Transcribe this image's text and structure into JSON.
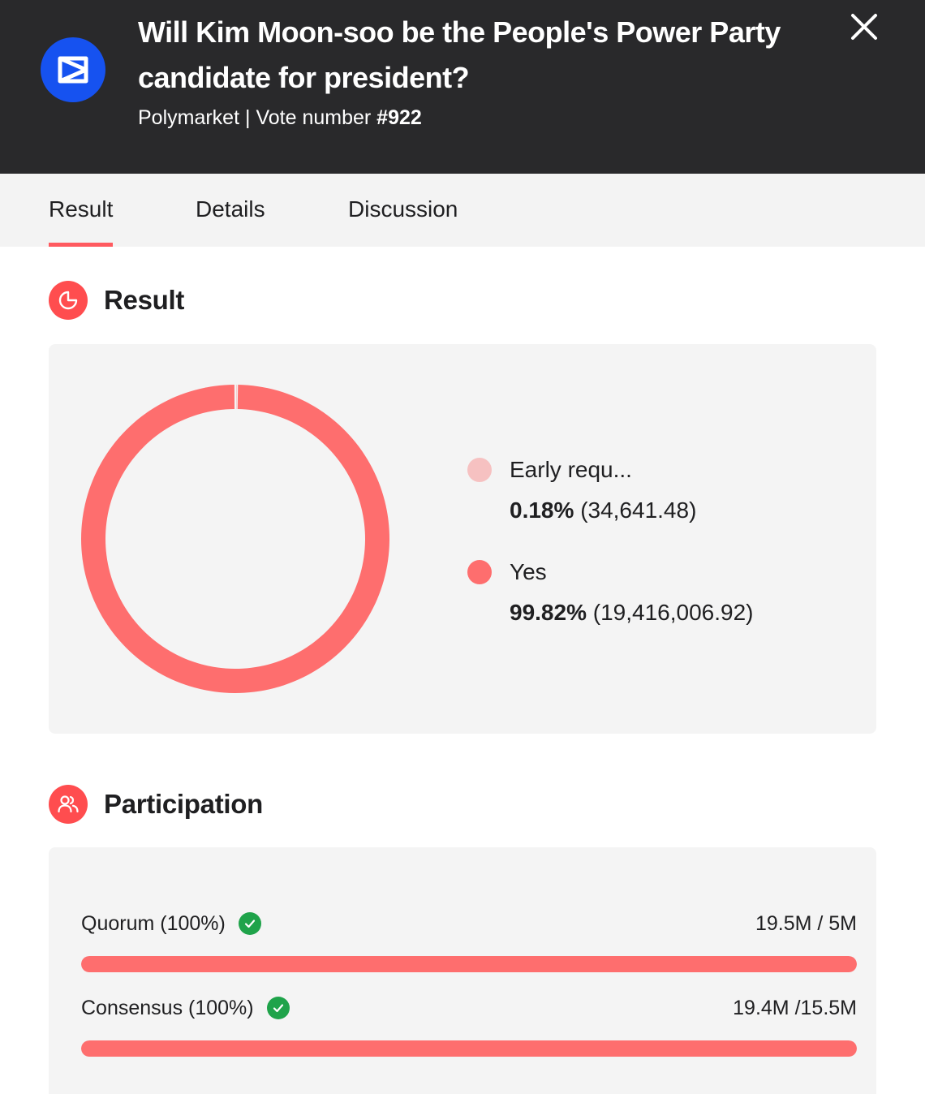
{
  "header": {
    "title": "Will Kim Moon-soo be the People's Power Party candidate for president?",
    "source": "Polymarket",
    "separator": "|",
    "vote_label": "Vote number",
    "vote_number": "#922",
    "logo_icon": "coinbase-base-logo-icon",
    "close_icon": "close-icon"
  },
  "tabs": [
    {
      "label": "Result",
      "active": true
    },
    {
      "label": "Details",
      "active": false
    },
    {
      "label": "Discussion",
      "active": false
    }
  ],
  "result": {
    "title": "Result",
    "icon": "pie-chart-icon"
  },
  "chart_data": {
    "type": "pie",
    "categories": [
      "Early requ...",
      "Yes"
    ],
    "values": [
      34641.48,
      19416006.92
    ],
    "percent_labels": [
      "0.18%",
      "99.82%"
    ],
    "value_labels": [
      "(34,641.48)",
      "(19,416,006.92)"
    ],
    "colors": [
      "#f6c1c1",
      "#fe6e6e"
    ],
    "title": "",
    "donut": true
  },
  "participation": {
    "title": "Participation",
    "icon": "users-icon",
    "rows": [
      {
        "label": "Quorum (100%)",
        "value": "19.5M / 5M",
        "progress": 1.0,
        "check_icon": "check-circle-icon"
      },
      {
        "label": "Consensus (100%)",
        "value": "19.4M /15.5M",
        "progress": 1.0,
        "check_icon": "check-circle-icon"
      }
    ]
  },
  "colors": {
    "header_bg": "#29292b",
    "accent": "#ff5a5f",
    "bar": "#fe6e6e",
    "success": "#1fa34a",
    "logo_bg": "#1652f0"
  }
}
